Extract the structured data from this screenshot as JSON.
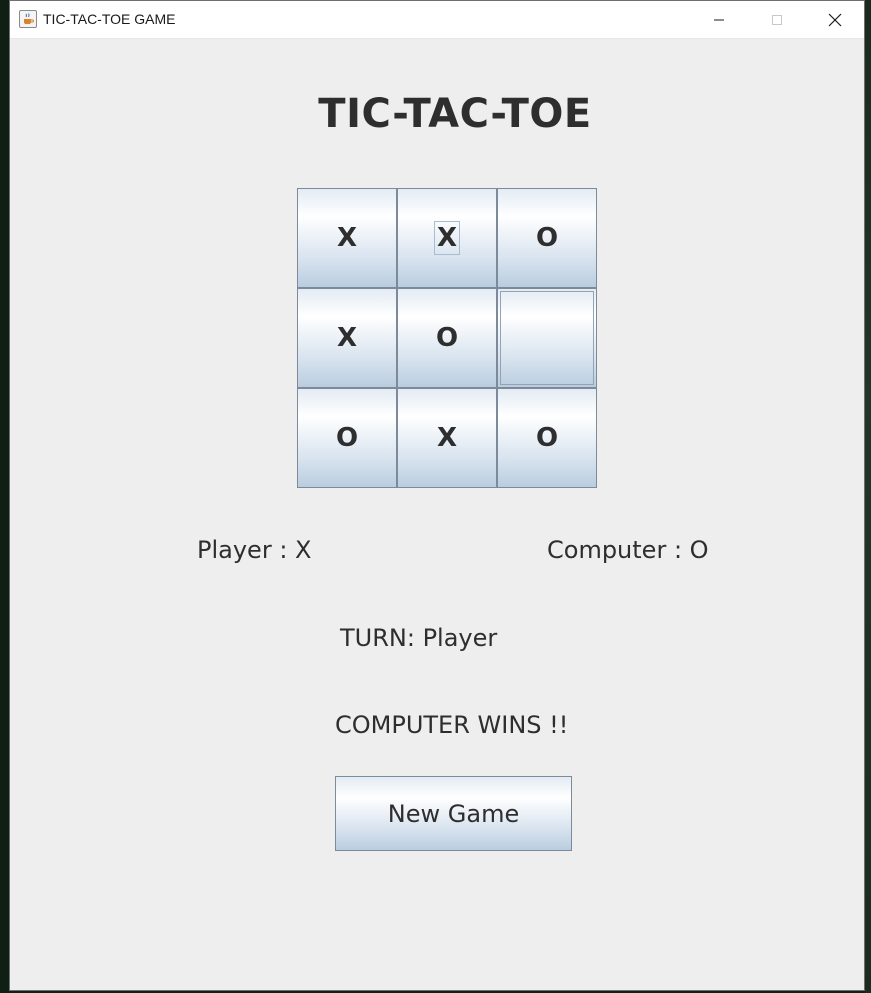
{
  "window": {
    "title": "TIC-TAC-TOE GAME",
    "icon": "java-cup-icon",
    "controls": [
      "minimize-icon",
      "maximize-icon",
      "close-icon"
    ]
  },
  "game": {
    "title": "TIC-TAC-TOE",
    "board": [
      [
        "X",
        "X",
        "O"
      ],
      [
        "X",
        "O",
        ""
      ],
      [
        "O",
        "X",
        "O"
      ]
    ],
    "player_label": "Player : X",
    "computer_label": "Computer : O",
    "turn_label": "TURN: Player",
    "result_label": "COMPUTER WINS !!",
    "new_game_label": "New Game"
  },
  "colors": {
    "window_bg": "#eeeeee",
    "text": "#2e2e2e",
    "button_border": "#7d8a99"
  }
}
